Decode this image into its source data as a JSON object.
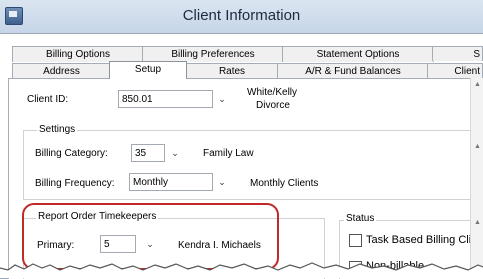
{
  "window": {
    "title": "Client Information"
  },
  "tabs_row1": [
    {
      "label": "Billing Options"
    },
    {
      "label": "Billing Preferences"
    },
    {
      "label": "Statement Options"
    },
    {
      "label": "S"
    }
  ],
  "tabs_row2": [
    {
      "label": "Address"
    },
    {
      "label": "Setup",
      "active": true
    },
    {
      "label": "Rates"
    },
    {
      "label": "A/R & Fund Balances"
    },
    {
      "label": "Client"
    }
  ],
  "client": {
    "id_label": "Client ID:",
    "id_value": "850.01",
    "name_line1": "White/Kelly",
    "name_line2": "Divorce"
  },
  "settings": {
    "title": "Settings",
    "billing_category_label": "Billing Category:",
    "billing_category_value": "35",
    "billing_category_desc": "Family Law",
    "billing_frequency_label": "Billing Frequency:",
    "billing_frequency_value": "Monthly",
    "billing_frequency_desc": "Monthly Clients"
  },
  "timekeepers": {
    "title": "Report Order Timekeepers",
    "primary_label": "Primary:",
    "primary_value": "5",
    "primary_name": "Kendra I. Michaels"
  },
  "status": {
    "title": "Status",
    "task_based_label": "Task Based Billing Client",
    "non_billable_label": "Non-billable"
  },
  "colors": {
    "highlight": "#c0282a",
    "titlebar": "#c6d5e8"
  }
}
